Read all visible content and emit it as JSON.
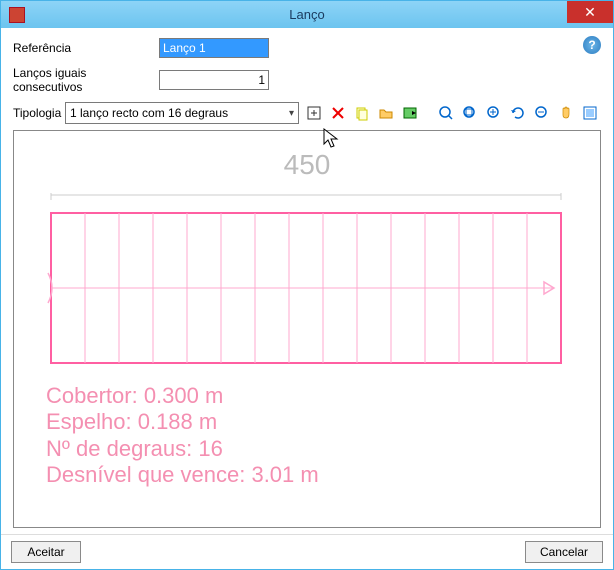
{
  "window": {
    "title": "Lanço"
  },
  "form": {
    "referencia_label": "Referência",
    "referencia_value": "Lanço 1",
    "consecutivos_label": "Lanços iguais consecutivos",
    "consecutivos_value": "1",
    "tipologia_label": "Tipologia",
    "tipologia_selected": "1 lanço recto com 16 degraus"
  },
  "canvas": {
    "dimension_top": "450",
    "info": {
      "cobertor": "Cobertor: 0.300 m",
      "espelho": "Espelho: 0.188 m",
      "degraus": "Nº de degraus: 16",
      "desnivel": "Desnível que vence: 3.01 m"
    }
  },
  "footer": {
    "accept": "Aceitar",
    "cancel": "Cancelar"
  },
  "chart_data": {
    "type": "diagram",
    "title": "Stair flight plan view",
    "width_label": 450,
    "steps": 16,
    "tread": 0.3,
    "riser": 0.188,
    "total_rise": 3.01
  }
}
